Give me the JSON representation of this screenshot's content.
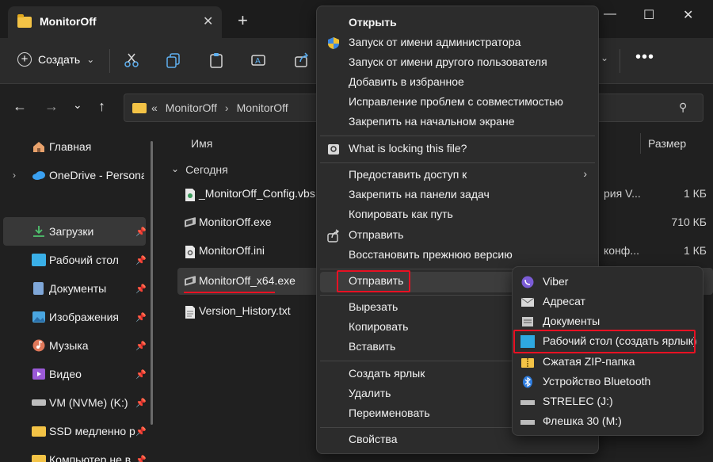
{
  "window": {
    "tab_title": "MonitorOff",
    "tab_close": "✕",
    "new_tab": "+",
    "minimize": "—",
    "maximize": "☐",
    "close": "✕"
  },
  "toolbar": {
    "create_label": "Создать",
    "create_chevron": "⌄",
    "more": "•••"
  },
  "nav": {
    "back": "←",
    "forward": "→",
    "recent": "⌄",
    "up": "↑",
    "breadcrumb_prefix": "«",
    "breadcrumbs": [
      "MonitorOff",
      "MonitorOff"
    ],
    "breadcrumb_sep": "›",
    "search": "⚲"
  },
  "sidebar": {
    "items": [
      {
        "label": "Главная",
        "icon": "home-icon",
        "color": "#e8a26c"
      },
      {
        "label": "OneDrive - Personal",
        "icon": "cloud-icon",
        "color": "#3aa0f0"
      },
      {
        "label": "Загрузки",
        "icon": "download-icon",
        "color": "#4fc36e"
      },
      {
        "label": "Рабочий стол",
        "icon": "desktop-icon",
        "color": "#3ab0e8"
      },
      {
        "label": "Документы",
        "icon": "document-icon",
        "color": "#7fa7d8"
      },
      {
        "label": "Изображения",
        "icon": "image-icon",
        "color": "#4aa6e0"
      },
      {
        "label": "Музыка",
        "icon": "music-icon",
        "color": "#e0785a"
      },
      {
        "label": "Видео",
        "icon": "video-icon",
        "color": "#9b5ad8"
      },
      {
        "label": "VM (NVMe) (K:)",
        "icon": "drive-icon",
        "color": "#bdbdbd"
      },
      {
        "label": "SSD медленно р",
        "icon": "folder-icon",
        "color": "#f3c346"
      },
      {
        "label": "Компьютер не в",
        "icon": "folder-icon",
        "color": "#f3c346"
      }
    ],
    "chevron": "›",
    "pin": "📌"
  },
  "filelist": {
    "col_name": "Имя",
    "col_size": "Размер",
    "group_chevron": "⌄",
    "group_label": "Сегодня",
    "files": [
      {
        "name": "_MonitorOff_Config.vbs",
        "type": "рия V...",
        "size": "1 КБ"
      },
      {
        "name": "MonitorOff.exe",
        "type": "",
        "size": "710 КБ"
      },
      {
        "name": "MonitorOff.ini",
        "type": "конф...",
        "size": "1 КБ"
      },
      {
        "name": "MonitorOff_x64.exe",
        "type": "",
        "size": ""
      },
      {
        "name": "Version_History.txt",
        "type": "",
        "size": ""
      }
    ]
  },
  "context_menu": {
    "groups": [
      [
        "Открыть",
        "Запуск от имени администратора",
        "Запуск от имени другого пользователя",
        "Добавить в избранное",
        "Исправление проблем с совместимостью",
        "Закрепить на начальном экране"
      ],
      [
        "What is locking this file?"
      ],
      [
        "Предоставить доступ к",
        "Закрепить на панели задач",
        "Копировать как путь",
        "Отправить",
        "Восстановить прежнюю версию"
      ],
      [
        "Отправить"
      ],
      [
        "Вырезать",
        "Копировать",
        "Вставить"
      ],
      [
        "Создать ярлык",
        "Удалить",
        "Переименовать"
      ],
      [
        "Свойства"
      ]
    ],
    "submenu_arrow": "›"
  },
  "send_to": {
    "items": [
      {
        "label": "Viber",
        "icon": "viber-icon",
        "color": "#7b5cd6"
      },
      {
        "label": "Адресат",
        "icon": "mail-icon",
        "color": "#d8d8d8"
      },
      {
        "label": "Документы",
        "icon": "document-icon",
        "color": "#c8c8c8"
      },
      {
        "label": "Рабочий стол (создать ярлык)",
        "icon": "desktop-icon",
        "color": "#2ea8e0"
      },
      {
        "label": "Сжатая ZIP-папка",
        "icon": "zip-folder-icon",
        "color": "#f3c346"
      },
      {
        "label": "Устройство Bluetooth",
        "icon": "bluetooth-icon",
        "color": "#2e7de0"
      },
      {
        "label": "STRELEC (J:)",
        "icon": "drive-icon",
        "color": "#bdbdbd"
      },
      {
        "label": "Флешка 30 (M:)",
        "icon": "drive-icon",
        "color": "#bdbdbd"
      }
    ]
  },
  "colors": {
    "highlight_red": "#e81123",
    "folder_yellow": "#f3c346",
    "background": "#202020"
  }
}
